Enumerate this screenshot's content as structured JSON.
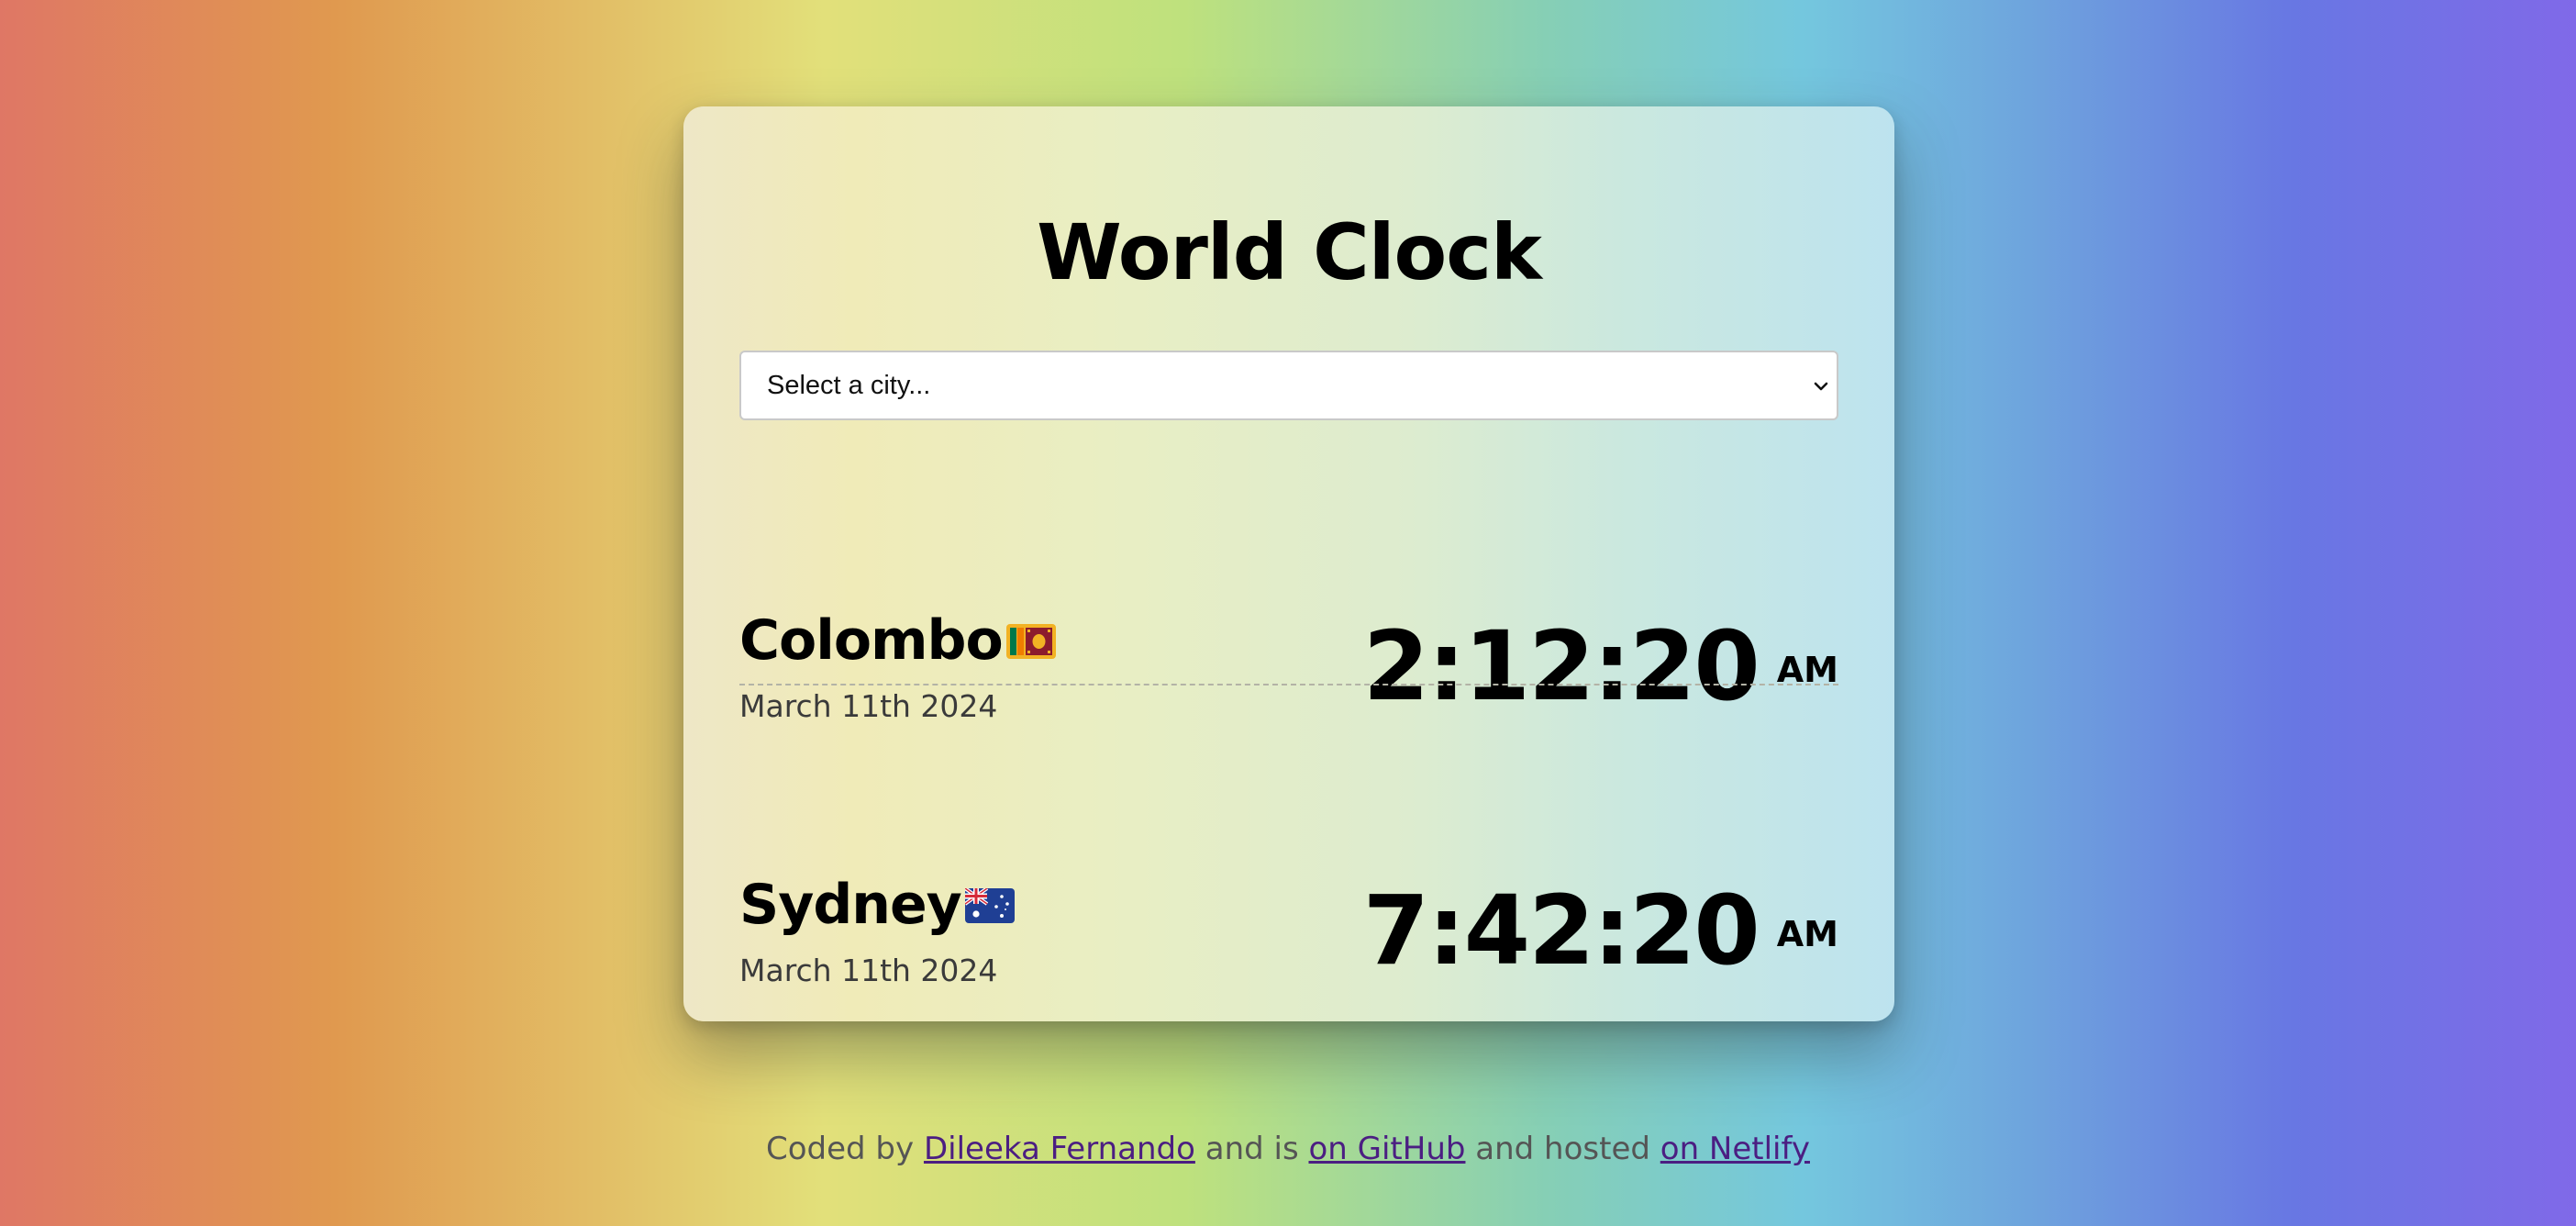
{
  "app": {
    "title": "World Clock"
  },
  "city_select": {
    "placeholder": "Select a city...",
    "selected": "Select a city..."
  },
  "cities": [
    {
      "name": "Colombo",
      "flag": "sri-lanka-flag-icon",
      "date": "March 11th 2024",
      "time": "2:12:20",
      "ampm": "AM"
    },
    {
      "name": "Sydney",
      "flag": "australia-flag-icon",
      "date": "March 11th 2024",
      "time": "7:42:20",
      "ampm": "AM"
    }
  ],
  "footer": {
    "prefix": "Coded by",
    "author_link": "Dileeka Fernando",
    "middle": "and is",
    "github_link": "on GitHub",
    "hosted": "and hosted",
    "netlify_link": "on Netlify"
  },
  "colors": {
    "card_text": "#000000",
    "date_text": "#3a3a3a",
    "link": "#4b1e82",
    "footer_text": "#555555"
  }
}
